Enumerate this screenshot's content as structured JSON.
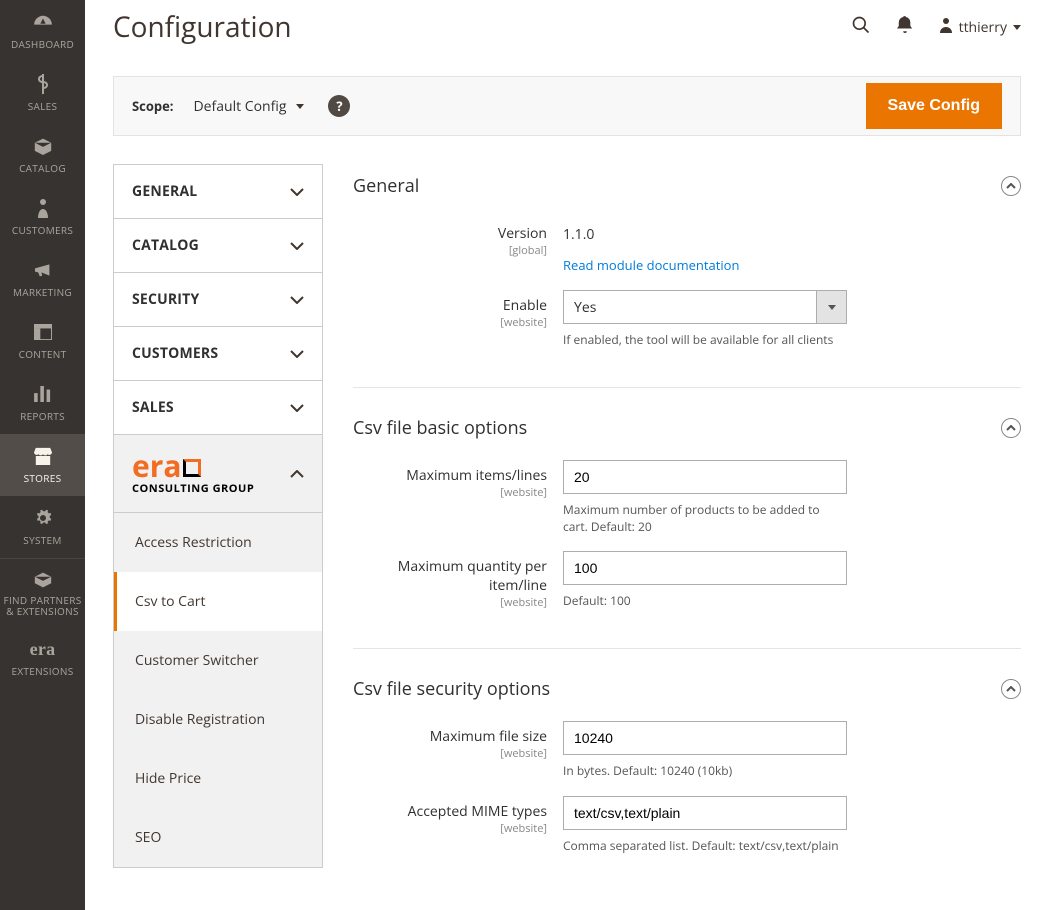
{
  "sidebar": {
    "items": [
      {
        "label": "DASHBOARD"
      },
      {
        "label": "SALES"
      },
      {
        "label": "CATALOG"
      },
      {
        "label": "CUSTOMERS"
      },
      {
        "label": "MARKETING"
      },
      {
        "label": "CONTENT"
      },
      {
        "label": "REPORTS"
      },
      {
        "label": "STORES"
      },
      {
        "label": "SYSTEM"
      },
      {
        "label": "FIND PARTNERS & EXTENSIONS"
      },
      {
        "label": "EXTENSIONS"
      }
    ]
  },
  "page_title": "Configuration",
  "username": "tthierry",
  "scope": {
    "label": "Scope:",
    "value": "Default Config"
  },
  "save_label": "Save Config",
  "config_nav": {
    "groups": [
      {
        "label": "GENERAL"
      },
      {
        "label": "CATALOG"
      },
      {
        "label": "SECURITY"
      },
      {
        "label": "CUSTOMERS"
      },
      {
        "label": "SALES"
      }
    ],
    "logo_sub": "CONSULTING GROUP",
    "items": [
      {
        "label": "Access Restriction"
      },
      {
        "label": "Csv to Cart"
      },
      {
        "label": "Customer Switcher"
      },
      {
        "label": "Disable Registration"
      },
      {
        "label": "Hide Price"
      },
      {
        "label": "SEO"
      }
    ]
  },
  "sections": {
    "general": {
      "title": "General",
      "version_label": "Version",
      "version_scope": "[global]",
      "version_value": "1.1.0",
      "doc_link": "Read module documentation",
      "enable_label": "Enable",
      "enable_scope": "[website]",
      "enable_value": "Yes",
      "enable_note": "If enabled, the tool will be available for all clients"
    },
    "csv_basic": {
      "title": "Csv file basic options",
      "max_items_label": "Maximum items/lines",
      "max_items_scope": "[website]",
      "max_items_value": "20",
      "max_items_note": "Maximum number of products to be added to cart. Default: 20",
      "max_qty_label": "Maximum quantity per item/line",
      "max_qty_scope": "[website]",
      "max_qty_value": "100",
      "max_qty_note": "Default: 100"
    },
    "csv_sec": {
      "title": "Csv file security options",
      "max_size_label": "Maximum file size",
      "max_size_scope": "[website]",
      "max_size_value": "10240",
      "max_size_note": "In bytes. Default: 10240 (10kb)",
      "mime_label": "Accepted MIME types",
      "mime_scope": "[website]",
      "mime_value": "text/csv,text/plain",
      "mime_note": "Comma separated list. Default: text/csv,text/plain"
    }
  }
}
